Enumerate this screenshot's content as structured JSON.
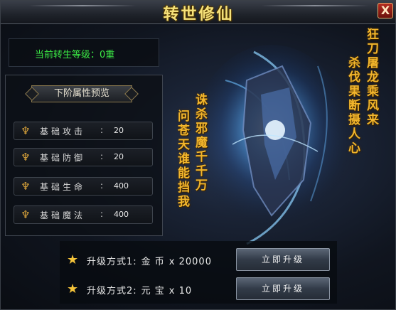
{
  "window": {
    "title": "转世修仙",
    "close_label": "X"
  },
  "rank": {
    "text": "当前转生等级：0重"
  },
  "panel": {
    "header": "下阶属性预览",
    "stats": [
      {
        "label": "基础攻击",
        "sep": ":",
        "value": "20"
      },
      {
        "label": "基础防御",
        "sep": ":",
        "value": "20"
      },
      {
        "label": "基础生命",
        "sep": ":",
        "value": "400"
      },
      {
        "label": "基础魔法",
        "sep": ":",
        "value": "400"
      }
    ]
  },
  "poem": {
    "line1": "狂刀屠龙乘风来",
    "line2": "杀伐果断摄人心",
    "line3": "诛杀邪魔千千万",
    "line4": "问苍天谁能挡我"
  },
  "upgrade": {
    "rows": [
      {
        "method": "升级方式1:",
        "currency": "金 币",
        "amount": "x 20000",
        "button": "立即升级"
      },
      {
        "method": "升级方式2:",
        "currency": "元 宝",
        "amount": "x 10",
        "button": "立即升级"
      }
    ]
  },
  "colors": {
    "title": "#f6e27a",
    "rank_text": "#3bea45",
    "poem": "#f2b62c",
    "star": "#f5c43a"
  },
  "icons": {
    "close": "close-icon",
    "stat": "trident-emblem-icon",
    "upgrade": "star-icon"
  }
}
